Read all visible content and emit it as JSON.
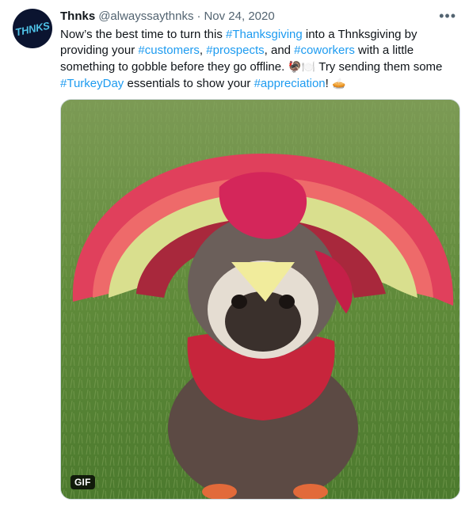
{
  "author": {
    "avatar_text": "THNKS",
    "display_name": "Thnks",
    "handle": "@alwayssaythnks",
    "separator": "·",
    "date": "Nov 24, 2020"
  },
  "more_label": "•••",
  "text": {
    "p1": "Now’s the best time to turn this ",
    "tag_thanksgiving": "#Thanksgiving",
    "p2": " into a Thnksgiving by providing your ",
    "tag_customers": "#customers",
    "c1": ", ",
    "tag_prospects": "#prospects",
    "p3": ", and ",
    "tag_coworkers": "#coworkers",
    "p4": " with a little something to gobble before they go offline. ",
    "emoji_turkey": "🦃",
    "emoji_utensils": "🍽️",
    "p5": " Try sending them some ",
    "tag_turkeyday": "#TurkeyDay",
    "p6": " essentials to show your ",
    "tag_appreciation": "#appreciation",
    "p7": "! ",
    "emoji_pie": "🥧"
  },
  "media": {
    "badge": "GIF"
  },
  "colors": {
    "link": "#1d9bf0",
    "text": "#0f1419",
    "muted": "#536471"
  }
}
